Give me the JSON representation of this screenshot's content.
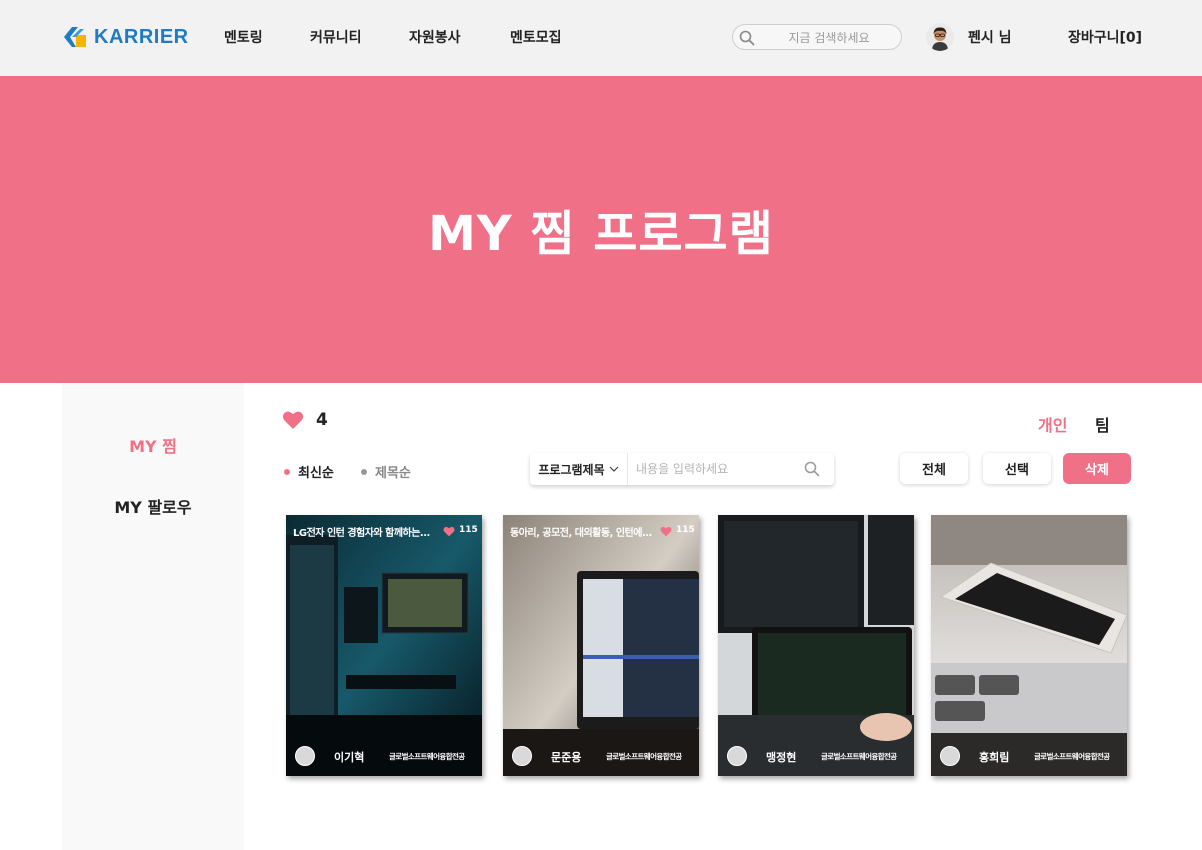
{
  "header": {
    "logo_text": "KARRIER",
    "nav": [
      "멘토링",
      "커뮤니티",
      "자원봉사",
      "멘토모집"
    ],
    "search_placeholder": "지금 검색하세요",
    "user_name": "펜시 님",
    "cart_label": "장바구니[0]"
  },
  "banner": {
    "title": "MY 찜 프로그램"
  },
  "sidebar": {
    "items": [
      {
        "label": "MY 찜",
        "active": true
      },
      {
        "label": "MY 팔로우",
        "active": false
      }
    ]
  },
  "content": {
    "like_count": "4",
    "tabs": [
      {
        "label": "개인",
        "active": true
      },
      {
        "label": "팀",
        "active": false
      }
    ],
    "sort": [
      {
        "label": "최신순",
        "active": true
      },
      {
        "label": "제목순",
        "active": false
      }
    ],
    "filter": {
      "selected": "프로그램제목",
      "placeholder": "내용을 입력하세요"
    },
    "buttons": {
      "all": "전체",
      "select": "선택",
      "delete": "삭제"
    },
    "cards": [
      {
        "title": "LG전자 인턴 경험자와 함께하는...",
        "likes": "115",
        "name": "이기혁",
        "major": "글로벌소프트웨어융합전공"
      },
      {
        "title": "동아리, 공모전, 대외활동, 인턴에...",
        "likes": "115",
        "name": "문준용",
        "major": "글로벌소프트웨어융합전공"
      },
      {
        "title": "",
        "likes": "",
        "name": "맹정현",
        "major": "글로벌소프트웨어융합전공"
      },
      {
        "title": "",
        "likes": "",
        "name": "홍희림",
        "major": "글로벌소프트웨어융합전공"
      }
    ]
  },
  "colors": {
    "accent": "#f07088",
    "logo": "#1f7bc8",
    "header_bg": "#f2f2f2",
    "sidebar_bg": "#f9f9f9"
  },
  "icons": {
    "search": "search-icon",
    "heart": "heart-icon",
    "chevron": "chevron-down-icon"
  }
}
